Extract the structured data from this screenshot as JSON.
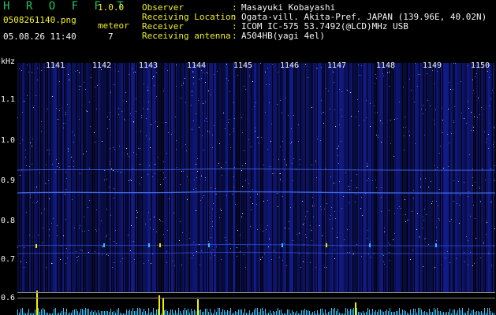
{
  "app": {
    "title": "H R O F F T",
    "version": "1.0.0"
  },
  "file": {
    "name": "0508261140.png",
    "datetime": "05.08.26 11:40"
  },
  "meteor": {
    "label": "meteor",
    "count": "7"
  },
  "metadata": [
    {
      "label": "Observer",
      "value": "Masayuki Kobayashi"
    },
    {
      "label": "Receiving Location",
      "value": "Ogata-vill. Akita-Pref. JAPAN (139.96E, 40.02N)"
    },
    {
      "label": "Receiver",
      "value": "ICOM IC-575 53.7492(@LCD)MHz USB"
    },
    {
      "label": "Receiving antenna",
      "value": "A504HB(yagi 4el)"
    }
  ],
  "axis": {
    "y_unit": "kHz",
    "y_ticks": [
      "1.1",
      "1.0",
      "0.9",
      "0.8",
      "0.7",
      "0.6"
    ],
    "x_ticks": [
      "1141",
      "1142",
      "1143",
      "1144",
      "1145",
      "1146",
      "1147",
      "1148",
      "1149",
      "1150"
    ]
  },
  "colors": {
    "background": "#000000",
    "title_green": "#22c45a",
    "accent_yellow": "#f2ee2a",
    "text_white": "#f4f4f4",
    "spectrogram_blue": "#1d2cc9",
    "amplitude_cyan": "#35c6ff"
  }
}
